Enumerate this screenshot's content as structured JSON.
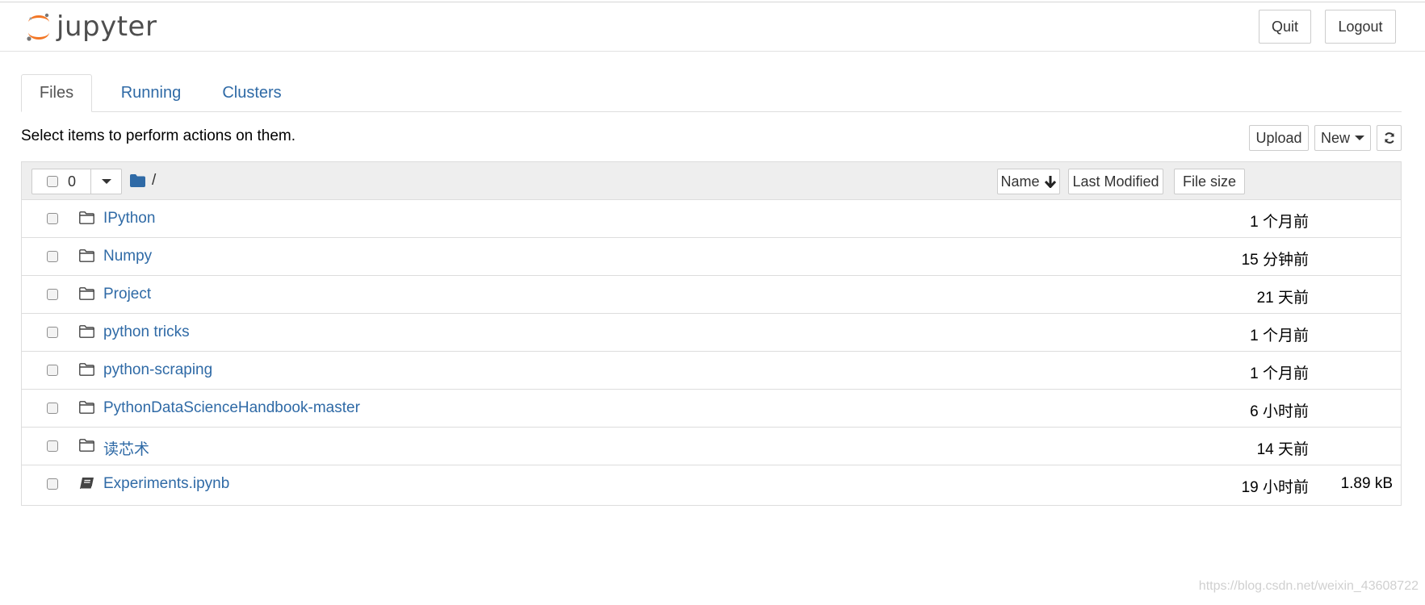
{
  "header": {
    "logo_text": "jupyter",
    "quit_label": "Quit",
    "logout_label": "Logout"
  },
  "tabs": [
    {
      "label": "Files",
      "active": true
    },
    {
      "label": "Running",
      "active": false
    },
    {
      "label": "Clusters",
      "active": false
    }
  ],
  "toolbar": {
    "hint": "Select items to perform actions on them.",
    "upload_label": "Upload",
    "new_label": "New"
  },
  "list_header": {
    "selected_count": "0",
    "breadcrumb": "/",
    "sort_name": "Name",
    "sort_modified": "Last Modified",
    "sort_size": "File size"
  },
  "files": [
    {
      "name": "IPython",
      "type": "folder",
      "modified": "1 个月前",
      "size": ""
    },
    {
      "name": "Numpy",
      "type": "folder",
      "modified": "15 分钟前",
      "size": ""
    },
    {
      "name": "Project",
      "type": "folder",
      "modified": "21 天前",
      "size": ""
    },
    {
      "name": "python tricks",
      "type": "folder",
      "modified": "1 个月前",
      "size": ""
    },
    {
      "name": "python-scraping",
      "type": "folder",
      "modified": "1 个月前",
      "size": ""
    },
    {
      "name": "PythonDataScienceHandbook-master",
      "type": "folder",
      "modified": "6 小时前",
      "size": ""
    },
    {
      "name": "读芯术",
      "type": "folder",
      "modified": "14 天前",
      "size": ""
    },
    {
      "name": "Experiments.ipynb",
      "type": "notebook",
      "modified": "19 小时前",
      "size": "1.89 kB"
    }
  ],
  "watermark": "https://blog.csdn.net/weixin_43608722",
  "colors": {
    "link": "#2f6aa6",
    "logo_orange": "#f37726",
    "border": "#dddddd",
    "header_bg": "#eeeeee"
  }
}
